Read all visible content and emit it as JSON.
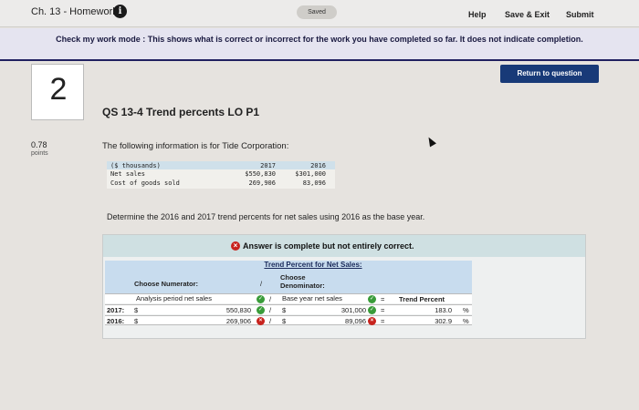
{
  "topbar": {
    "course_title": "Ch. 13 - Homework",
    "info_icon": "i",
    "saved_label": "Saved",
    "help_label": "Help",
    "save_exit_label": "Save & Exit",
    "submit_label": "Submit"
  },
  "banner": {
    "text": "Check my work mode : This shows what is correct or incorrect for the work you have completed so far. It does not indicate completion."
  },
  "return_button": "Return to question",
  "question": {
    "number": "2",
    "title": "QS 13-4 Trend percents LO P1",
    "points_value": "0.78",
    "points_label": "points",
    "info_text": "The following information is for Tide Corporation:",
    "instruction": "Determine the 2016 and 2017 trend percents for net sales using 2016 as the base year."
  },
  "data_table": {
    "headers": [
      "($ thousands)",
      "2017",
      "2016"
    ],
    "rows": [
      [
        "Net sales",
        "$550,830",
        "$301,000"
      ],
      [
        "Cost of goods sold",
        "269,906",
        "83,096"
      ]
    ]
  },
  "answer": {
    "status_icon": "×",
    "status": "Answer is complete but not entirely correct.",
    "trend_title": "Trend Percent for Net Sales:",
    "numerator_header": "Choose Numerator:",
    "slash": "/",
    "denominator_header_line1": "Choose",
    "denominator_header_line2": "Denominator:",
    "equals": "=",
    "numerator_choice": "Analysis period net sales",
    "denominator_choice": "Base year net sales",
    "result_header": "Trend Percent",
    "rows": [
      {
        "year": "2017:",
        "num_currency": "$",
        "num_value": "550,830",
        "den_currency": "$",
        "den_value": "301,000",
        "result": "183.0",
        "unit": "%"
      },
      {
        "year": "2016:",
        "num_currency": "$",
        "num_value": "269,906",
        "den_currency": "$",
        "den_value": "89,096",
        "result": "302.9",
        "unit": "%"
      }
    ],
    "check_glyph": "✓",
    "x_glyph": "×"
  }
}
